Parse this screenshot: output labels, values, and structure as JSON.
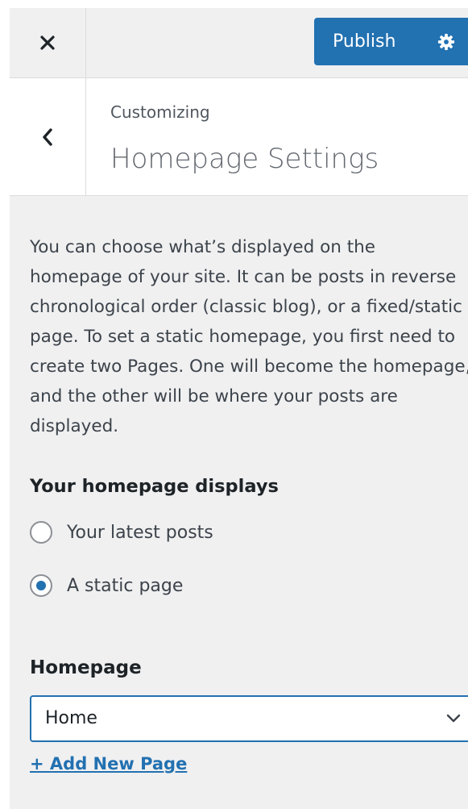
{
  "header": {
    "close_icon": "close-icon",
    "publish_label": "Publish",
    "settings_icon": "gear-icon",
    "accent_color": "#2271b1"
  },
  "section": {
    "back_icon": "chevron-left-icon",
    "breadcrumb": "Customizing",
    "title": "Homepage Settings"
  },
  "description": "You can choose what’s displayed on the homepage of your site. It can be posts in reverse chronological order (classic blog), or a fixed/static page. To set a static homepage, you first need to create two Pages. One will become the homepage, and the other will be where your posts are displayed.",
  "homepage_displays": {
    "label": "Your homepage displays",
    "options": [
      {
        "label": "Your latest posts",
        "checked": false
      },
      {
        "label": "A static page",
        "checked": true
      }
    ]
  },
  "homepage_select": {
    "label": "Homepage",
    "value": "Home",
    "chevron_icon": "chevron-down-icon"
  },
  "add_new_page_label": "+ Add New Page"
}
